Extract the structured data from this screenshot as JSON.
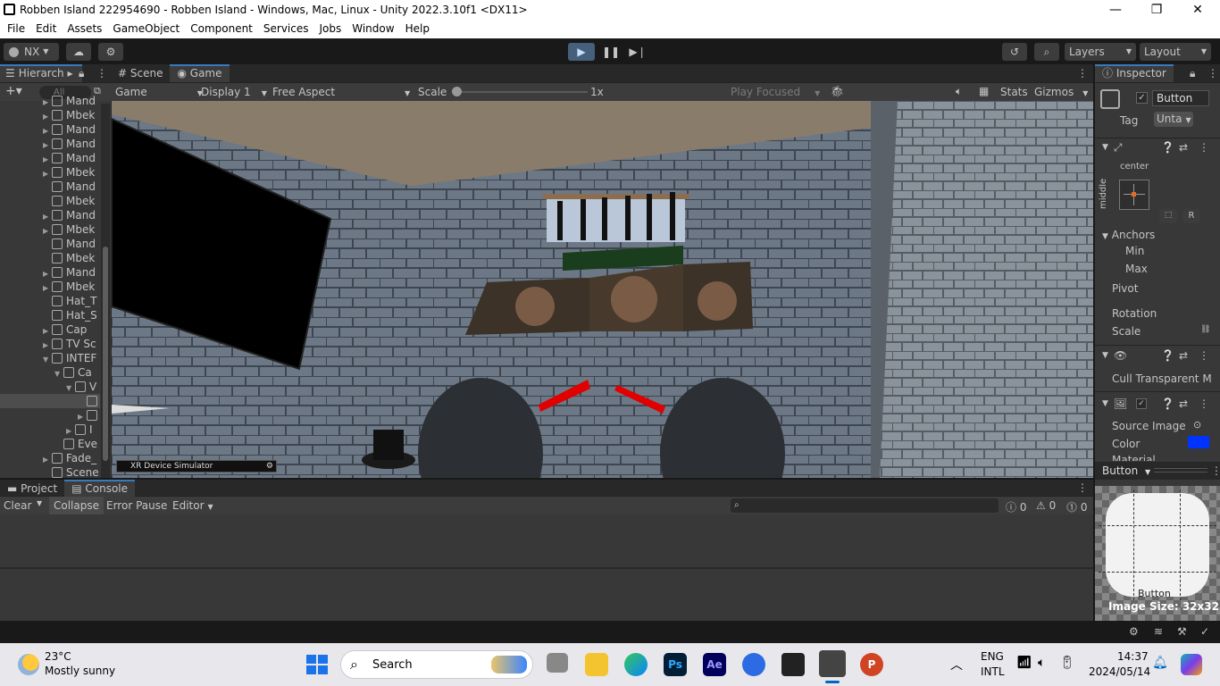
{
  "window": {
    "title": "Robben Island 222954690 - Robben Island - Windows, Mac, Linux - Unity 2022.3.10f1 <DX11>",
    "minimize": "—",
    "restore": "❐",
    "close": "✕"
  },
  "menu": [
    "File",
    "Edit",
    "Assets",
    "GameObject",
    "Component",
    "Services",
    "Jobs",
    "Window",
    "Help"
  ],
  "toolbar": {
    "account": "NX",
    "layers": "Layers",
    "layout": "Layout"
  },
  "hierarchy": {
    "tab": "Hierarch",
    "search_placeholder": "All",
    "items": [
      {
        "label": "Mand",
        "indent": 0,
        "arrow": "▶"
      },
      {
        "label": "Mbek",
        "indent": 0,
        "arrow": "▶"
      },
      {
        "label": "Mand",
        "indent": 0,
        "arrow": "▶"
      },
      {
        "label": "Mand",
        "indent": 0,
        "arrow": "▶"
      },
      {
        "label": "Mand",
        "indent": 0,
        "arrow": "▶"
      },
      {
        "label": "Mbek",
        "indent": 0,
        "arrow": "▶"
      },
      {
        "label": "Mand",
        "indent": 0,
        "arrow": ""
      },
      {
        "label": "Mbek",
        "indent": 0,
        "arrow": ""
      },
      {
        "label": "Mand",
        "indent": 0,
        "arrow": "▶"
      },
      {
        "label": "Mbek",
        "indent": 0,
        "arrow": "▶"
      },
      {
        "label": "Mand",
        "indent": 0,
        "arrow": ""
      },
      {
        "label": "Mbek",
        "indent": 0,
        "arrow": ""
      },
      {
        "label": "Mand",
        "indent": 0,
        "arrow": "▶"
      },
      {
        "label": "Mbek",
        "indent": 0,
        "arrow": "▶"
      },
      {
        "label": "Hat_T",
        "indent": 0,
        "arrow": ""
      },
      {
        "label": "Hat_S",
        "indent": 0,
        "arrow": ""
      },
      {
        "label": "Cap",
        "indent": 0,
        "arrow": "▶"
      },
      {
        "label": "TV Sc",
        "indent": 0,
        "arrow": "▶"
      },
      {
        "label": "INTEF",
        "indent": 0,
        "arrow": "▼"
      },
      {
        "label": "Ca",
        "indent": 1,
        "arrow": "▼"
      },
      {
        "label": "V",
        "indent": 2,
        "arrow": "▼"
      },
      {
        "label": "",
        "indent": 3,
        "arrow": ""
      },
      {
        "label": "",
        "indent": 3,
        "arrow": "▶"
      },
      {
        "label": "I",
        "indent": 2,
        "arrow": "▶"
      },
      {
        "label": "Eve",
        "indent": 1,
        "arrow": ""
      },
      {
        "label": "Fade_",
        "indent": 0,
        "arrow": "▶"
      },
      {
        "label": "Scene",
        "indent": 0,
        "arrow": ""
      }
    ]
  },
  "game_view": {
    "tabs": [
      "Scene",
      "Game"
    ],
    "mode": "Game",
    "display": "Display 1",
    "aspect": "Free Aspect",
    "scale_label": "Scale",
    "scale_value": "1x",
    "play_focused": "Play Focused",
    "stats": "Stats",
    "gizmos": "Gizmos",
    "xr_sim": "XR Device Simulator"
  },
  "inspector": {
    "tab": "Inspector",
    "object_name": "Button",
    "tag_label": "Tag",
    "tag_value": "Unta",
    "anchor_h": "center",
    "anchor_v": "middle",
    "r_button": "R",
    "anchors": "Anchors",
    "min": "Min",
    "max": "Max",
    "pivot": "Pivot",
    "rotation": "Rotation",
    "scale": "Scale",
    "cull": "Cull Transparent M",
    "source_image": "Source Image",
    "color_label": "Color",
    "material": "Material",
    "color_value": "#0033ff",
    "preview_title": "Button",
    "preview_caption": "Button",
    "image_size": "Image Size: 32x32"
  },
  "bottom": {
    "tabs": [
      "Project",
      "Console"
    ],
    "clear": "Clear",
    "collapse": "Collapse",
    "error_pause": "Error Pause",
    "editor": "Editor",
    "count_info": "0",
    "count_warn": "0",
    "count_err": "0"
  },
  "taskbar": {
    "temp": "23°C",
    "weather": "Mostly sunny",
    "search": "Search",
    "lang1": "ENG",
    "lang2": "INTL",
    "time": "14:37",
    "date": "2024/05/14"
  }
}
